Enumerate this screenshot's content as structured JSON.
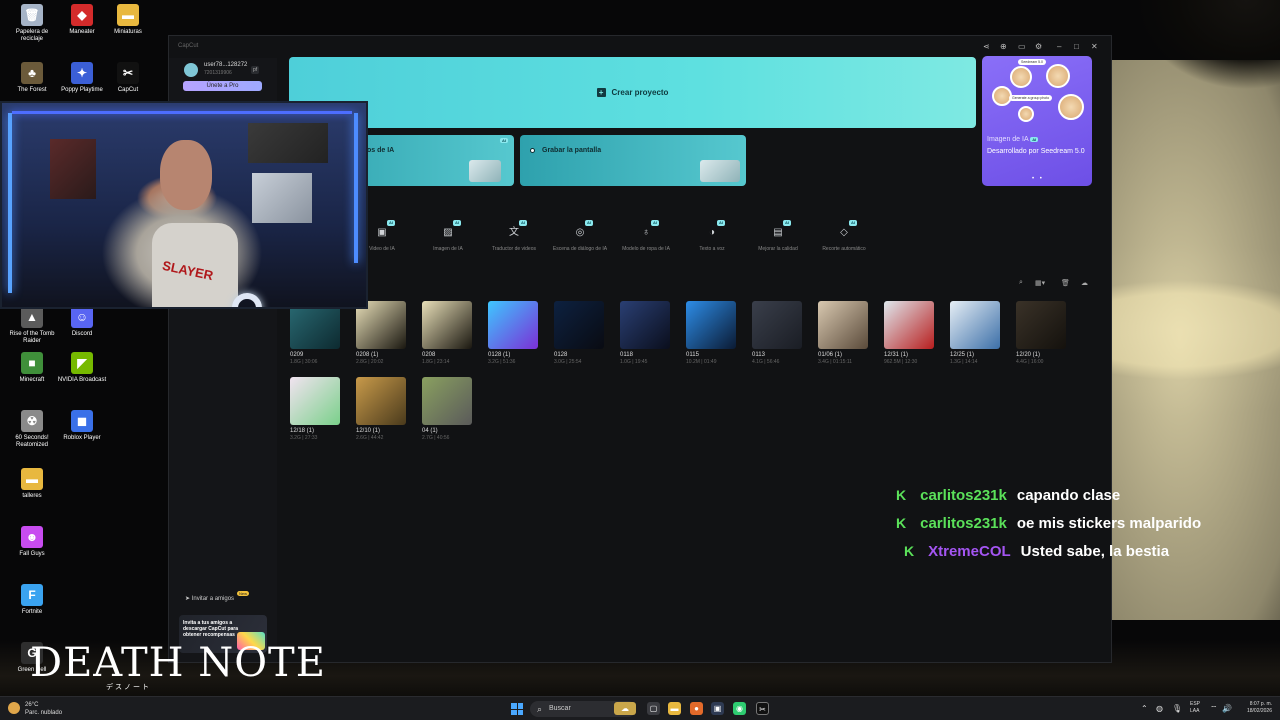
{
  "desktop": {
    "icons": [
      {
        "label": "Papelera de reciclaje",
        "glyph": "🗑",
        "color": "#a6b4c7"
      },
      {
        "label": "Maneater",
        "glyph": "◆",
        "color": "#d42b2b"
      },
      {
        "label": "Miniaturas",
        "glyph": "▬",
        "color": "#e8b83f"
      },
      {
        "label": "The Forest",
        "glyph": "♣",
        "color": "#6b5a3a"
      },
      {
        "label": "Poppy Playtime",
        "glyph": "✦",
        "color": "#3b5fd6"
      },
      {
        "label": "CapCut",
        "glyph": "✂",
        "color": "#111111"
      },
      {
        "label": "Rise of the Tomb Raider",
        "glyph": "▲",
        "color": "#5b5b5b"
      },
      {
        "label": "Discord",
        "glyph": "☺",
        "color": "#5865f2"
      },
      {
        "label": "Minecraft",
        "glyph": "■",
        "color": "#3f8f3a"
      },
      {
        "label": "NVIDIA Broadcast",
        "glyph": "◤",
        "color": "#76b900"
      },
      {
        "label": "60 Seconds! Reatomized",
        "glyph": "☢",
        "color": "#8a8a8a"
      },
      {
        "label": "Roblox Player",
        "glyph": "◼",
        "color": "#3a70e8"
      },
      {
        "label": "talleres",
        "glyph": "▬",
        "color": "#e8b83f"
      },
      {
        "label": "Fall Guys",
        "glyph": "☻",
        "color": "#c84cf0"
      },
      {
        "label": "Fortnite",
        "glyph": "F",
        "color": "#3aa3f0"
      },
      {
        "label": "Green Hell",
        "glyph": "G",
        "color": "#2e2e2e"
      }
    ],
    "brand_text": "DEATH NOTE",
    "brand_sub": "デスノート"
  },
  "capcut": {
    "app_name": "CapCut",
    "user": {
      "name": "user78...128272",
      "id": "7201319906",
      "tag": "pf"
    },
    "pro_button": "Únete a Pro",
    "create_project": "Crear proyecto",
    "cards": [
      {
        "label": "os de IA",
        "badge": "AI"
      },
      {
        "label": "Grabar la pantalla",
        "badge": ""
      }
    ],
    "promo_card": {
      "title": "Imagen de IA",
      "badge": "AI",
      "subtitle": "Desarrollado por Seedream 5.0",
      "pill": "Generate a group photo",
      "model_tag": "Seedream 5.0"
    },
    "tools": [
      {
        "label": "Video de IA",
        "icon": "▣",
        "badge": "AI"
      },
      {
        "label": "Imagen de IA",
        "icon": "▨",
        "badge": "AI"
      },
      {
        "label": "Traductor de videos",
        "icon": "文",
        "badge": "AI"
      },
      {
        "label": "Escena de diálogo de IA",
        "icon": "◎",
        "badge": "AI"
      },
      {
        "label": "Modelo de ropa de IA",
        "icon": "♁",
        "badge": "AI"
      },
      {
        "label": "Texto a voz",
        "icon": "◑",
        "badge": "AI"
      },
      {
        "label": "Mejorar la calidad",
        "icon": "▤",
        "badge": "AI"
      },
      {
        "label": "Recorte automático",
        "icon": "◇",
        "badge": "AI"
      }
    ],
    "projects": [
      {
        "name": "0209",
        "meta": "1.8G | 30:06",
        "c1": "#2a6b74",
        "c2": "#0d2a30"
      },
      {
        "name": "0208 (1)",
        "meta": "2.8G | 20:02",
        "c1": "#e8dfb8",
        "c2": "#1a1710"
      },
      {
        "name": "0208",
        "meta": "1.8G | 23:14",
        "c1": "#e8dfb8",
        "c2": "#1a1710"
      },
      {
        "name": "0128 (1)",
        "meta": "3.2G | 51:36",
        "c1": "#3ec7ff",
        "c2": "#7b2fd6"
      },
      {
        "name": "0128",
        "meta": "3.0G | 25:54",
        "c1": "#0d2140",
        "c2": "#090b12"
      },
      {
        "name": "0118",
        "meta": "1.0G | 19:45",
        "c1": "#2a3f73",
        "c2": "#0a0e1c"
      },
      {
        "name": "0115",
        "meta": "10.2M | 01:49",
        "c1": "#2d8de8",
        "c2": "#0b1a33"
      },
      {
        "name": "0113",
        "meta": "4.1G | 56:46",
        "c1": "#3a3f4b",
        "c2": "#1a1d24"
      },
      {
        "name": "01/06 (1)",
        "meta": "3.4G | 01:15:11",
        "c1": "#d8c8b0",
        "c2": "#5a4a3a"
      },
      {
        "name": "12/31 (1)",
        "meta": "962.5M | 12:30",
        "c1": "#dfe8ee",
        "c2": "#b81e1e"
      },
      {
        "name": "12/25 (1)",
        "meta": "1.3G | 14:14",
        "c1": "#e6eef5",
        "c2": "#3c6fa8"
      },
      {
        "name": "12/20 (1)",
        "meta": "4.4G | 16:00",
        "c1": "#3a3228",
        "c2": "#14110d"
      },
      {
        "name": "12/18 (1)",
        "meta": "3.2G | 27:33",
        "c1": "#f1e3f0",
        "c2": "#7ad08a"
      },
      {
        "name": "12/10 (1)",
        "meta": "2.6G | 44:42",
        "c1": "#c89a4a",
        "c2": "#4a3a1c"
      },
      {
        "name": "04 (1)",
        "meta": "2.7G | 40:56",
        "c1": "#8aa060",
        "c2": "#5a5a5a"
      }
    ],
    "invite_label": "Invitar a amigos",
    "invite_badge": "New",
    "promo_text": "Invita a tus amigos a descargar CapCut para obtener recompensas"
  },
  "chat": [
    {
      "user": "carlitos231k",
      "message": "capando clase",
      "user_color": "#5be15a"
    },
    {
      "user": "carlitos231k",
      "message": "oe mis stickers malparido",
      "user_color": "#5be15a"
    },
    {
      "user": "XtremeCOL",
      "message": "Usted sabe, la bestia",
      "user_color": "#a455f2"
    }
  ],
  "taskbar": {
    "weather_temp": "26°C",
    "weather_desc": "Parc. nublado",
    "search_placeholder": "Buscar",
    "lang": "ESP",
    "lang_sub": "LAA",
    "time": "8:07 p. m.",
    "date": "18/02/2026"
  }
}
